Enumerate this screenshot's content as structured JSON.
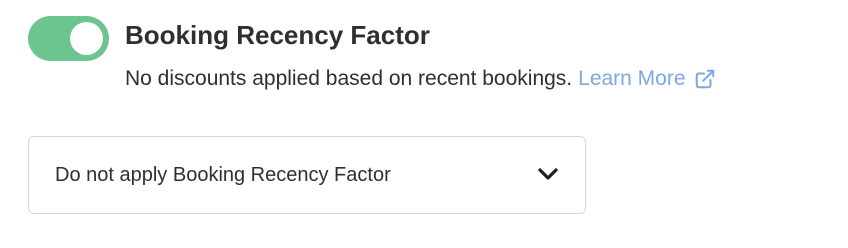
{
  "setting": {
    "enabled": true,
    "title": "Booking Recency Factor",
    "description": "No discounts applied based on recent bookings.",
    "learn_more_label": "Learn More",
    "learn_more_icon": "external-link-icon"
  },
  "dropdown": {
    "selected_value": "Do not apply Booking Recency Factor",
    "icon": "chevron-down-icon"
  },
  "colors": {
    "toggle_on": "#6cc490",
    "link": "#7ea8e0",
    "text": "#2f2f2f",
    "border": "#d6d6d6"
  }
}
